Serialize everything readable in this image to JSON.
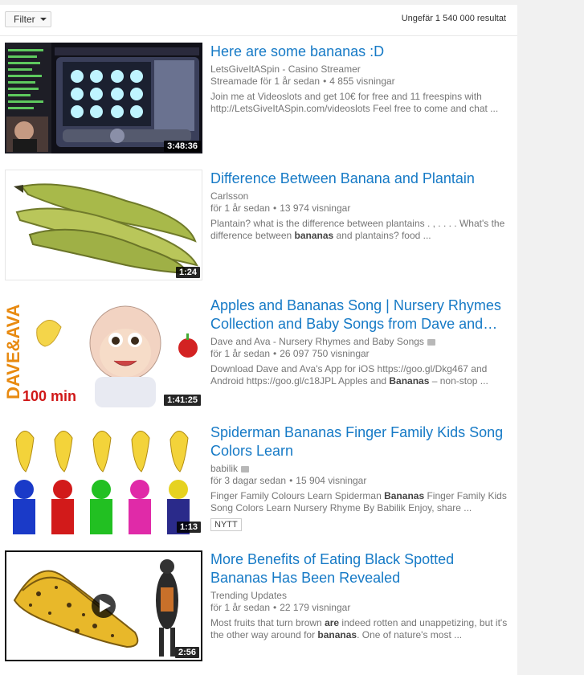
{
  "topbar": {
    "filter_label": "Filter",
    "result_count": "Ungefär 1 540 000 resultat"
  },
  "results": [
    {
      "title": "Here are some bananas :D",
      "channel": "LetsGiveItASpin - Casino Streamer",
      "age": "Streamade för 1 år sedan",
      "views": "4 855 visningar",
      "desc_parts": [
        "Join me at Videoslots and get 10€ for free and 11 freespins with http://LetsGiveItASpin.com/videoslots Feel free to come and chat ..."
      ],
      "duration": "3:48:36",
      "verified": false
    },
    {
      "title": "Difference Between Banana and Plantain",
      "channel": "Carlsson",
      "age": "för 1 år sedan",
      "views": "13 974 visningar",
      "desc_parts": [
        "Plantain? what is the difference between plantains . , . . . . What's the difference between ",
        "bananas",
        " and plantains? food ..."
      ],
      "duration": "1:24",
      "verified": false
    },
    {
      "title": "Apples and Bananas Song | Nursery Rhymes Collection and Baby Songs from Dave and…",
      "channel": "Dave and Ava - Nursery Rhymes and Baby Songs",
      "age": "för 1 år sedan",
      "views": "26 097 750 visningar",
      "desc_parts": [
        "Download Dave and Ava's App for iOS https://goo.gl/Dkg467 and Android https://goo.gl/c18JPL Apples and ",
        "Bananas",
        " – non-stop ..."
      ],
      "duration": "1:41:25",
      "verified": true,
      "thumb_text": "100 min",
      "logo_text": "DAVE&AVA"
    },
    {
      "title": "Spiderman Bananas Finger Family Kids Song Colors Learn",
      "channel": "babilik",
      "age": "för 3 dagar sedan",
      "views": "15 904 visningar",
      "desc_parts": [
        "Finger Family Colours Learn Spiderman ",
        "Bananas",
        " Finger Family Kids Song Colors Learn Nursery Rhyme By Babilik Enjoy, share ..."
      ],
      "duration": "1:13",
      "verified": true,
      "badge": "NYTT"
    },
    {
      "title": "More Benefits of Eating Black Spotted Bananas Has Been Revealed",
      "channel": "Trending Updates",
      "age": "för 1 år sedan",
      "views": "22 179 visningar",
      "desc_parts": [
        "Most fruits that turn brown ",
        "are",
        " indeed rotten and unappetizing, but it's the other way around for ",
        "bananas",
        ". One of nature's most ..."
      ],
      "duration": "2:56",
      "verified": false
    }
  ],
  "colors": {
    "link": "#167ac6",
    "meta": "#767676",
    "page_bg": "#f1f1f1"
  }
}
